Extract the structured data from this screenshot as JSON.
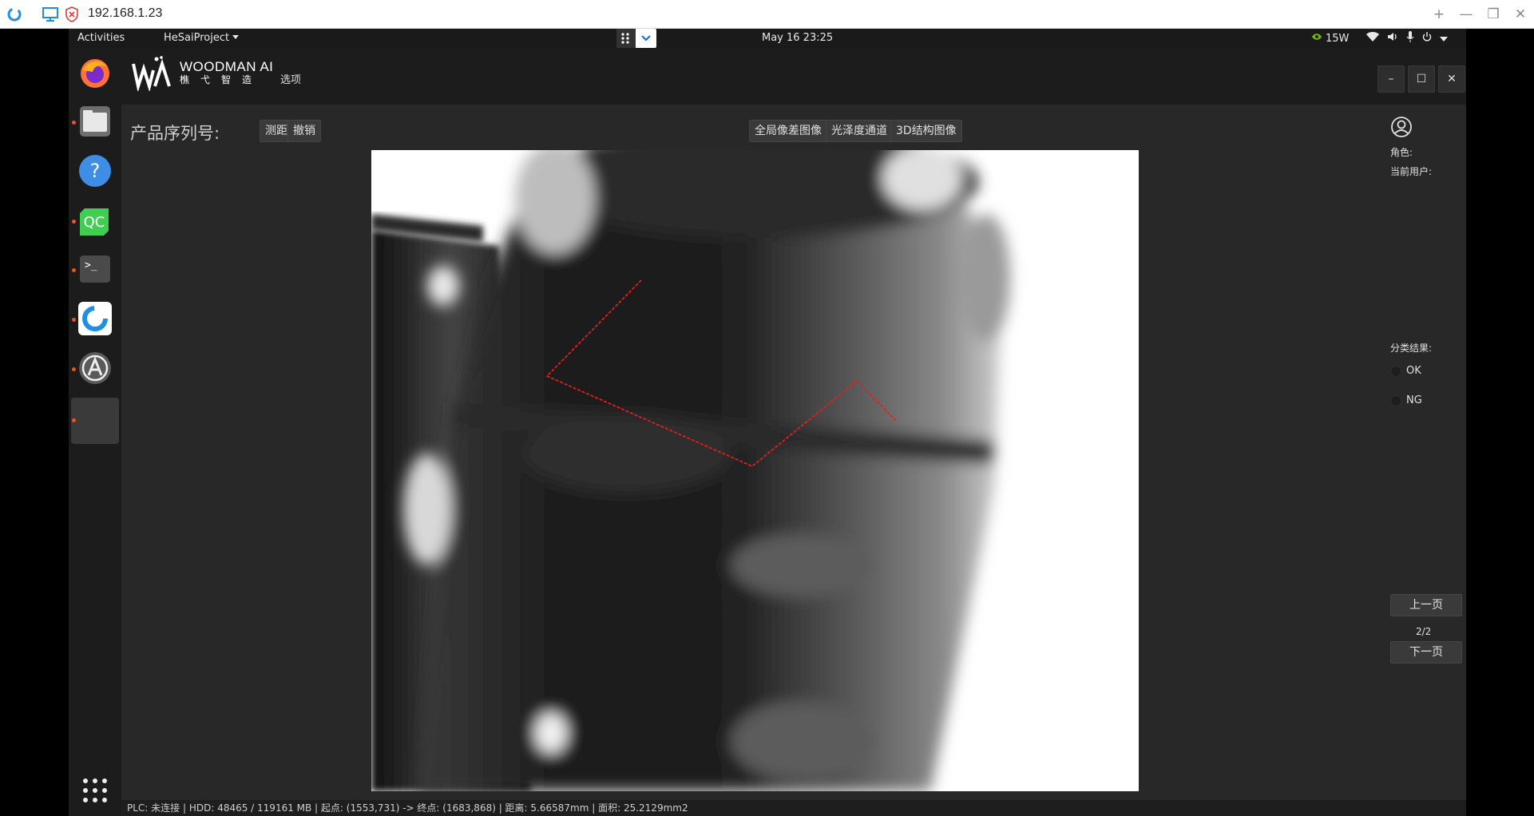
{
  "remote_viewer": {
    "address": "192.168.1.23",
    "controls": [
      "+",
      "—",
      "❐",
      "✕"
    ]
  },
  "gnome_topbar": {
    "activities": "Activities",
    "app_menu": "HeSaiProject",
    "clock": "May 16  23:25",
    "power": "15W"
  },
  "dock": {
    "items": [
      "firefox-icon",
      "files-icon",
      "help-icon",
      "qt-creator-icon",
      "terminal-icon",
      "remote-desktop-icon",
      "software-updater-icon",
      "running-app-icon"
    ]
  },
  "app": {
    "brand_name": "WOODMAN AI",
    "brand_sub": "樵弋智造",
    "options_label": "选项",
    "serial_label": "产品序列号:",
    "measure_button": "测距",
    "undo_button": "撤销",
    "view_tabs": [
      "全局像差图像",
      "光泽度通道",
      "3D结构图像"
    ],
    "role_label": "角色:",
    "current_user_label": "当前用户:",
    "classification_label": "分类结果:",
    "ok_label": "OK",
    "ng_label": "NG",
    "prev_page": "上一页",
    "page_indicator": "2/2",
    "next_page": "下一页",
    "status_text": "PLC: 未连接 | HDD: 48465 / 119161 MB | 起点: (1553,731) -> 终点: (1683,868) | 距离: 5.66587mm | 面积: 25.2129mm2"
  },
  "colors": {
    "accent_red": "#e0201e",
    "ubuntu_orange": "#e95420",
    "firefox_orange": "#ff7139",
    "help_blue": "#3d8ee4",
    "qt_green": "#41cd52"
  }
}
